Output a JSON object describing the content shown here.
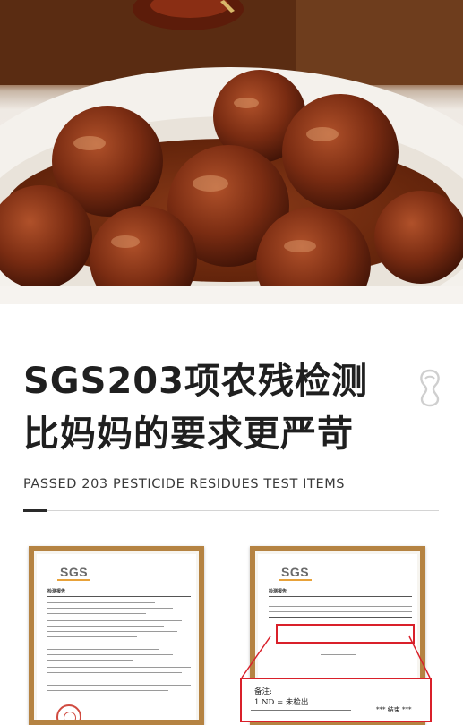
{
  "headline": {
    "line1": "SGS203项农残检测",
    "line2": "比妈妈的要求更严苛"
  },
  "subtitle": "PASSED 203 PESTICIDE RESIDUES TEST ITEMS",
  "certificates": [
    {
      "logo": "SGS",
      "heading": "检测报告"
    },
    {
      "logo": "SGS",
      "heading": "检测报告"
    }
  ],
  "zoom": {
    "note_label": "备注:",
    "note_item": "1.ND = 未检出",
    "end_mark": "*** 结束 ***"
  },
  "colors": {
    "frame": "#b58342",
    "highlight": "#d9202a",
    "headline": "#1f1f1f"
  },
  "icons": [
    "decorative-outline-icon",
    "seal-stamp-icon"
  ]
}
